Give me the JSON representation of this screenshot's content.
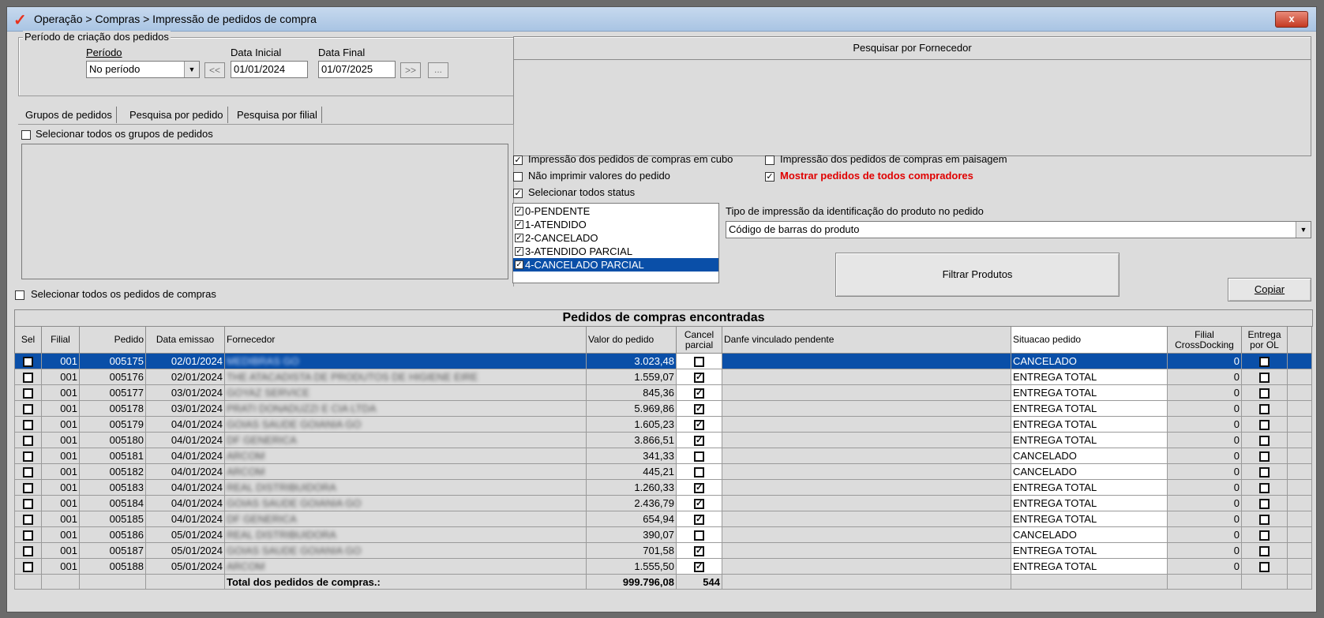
{
  "window": {
    "title": "Operação > Compras > Impressão de pedidos de compra",
    "close_label": "x"
  },
  "periodo": {
    "group_label": "Período de criação dos pedidos",
    "periodo_label": "Período",
    "periodo_value": "No período",
    "data_inicial_label": "Data Inicial",
    "data_inicial_value": "01/01/2024",
    "data_final_label": "Data Final",
    "data_final_value": "01/07/2025",
    "prev_label": "<<",
    "next_label": ">>",
    "more_label": "..."
  },
  "fornecedor": {
    "header": "Pesquisar por Fornecedor"
  },
  "tabs": [
    {
      "label": "Grupos de pedidos"
    },
    {
      "label": "Pesquisa por pedido"
    },
    {
      "label": "Pesquisa por filial"
    }
  ],
  "grupos": {
    "select_all_label": "Selecionar todos os grupos de pedidos"
  },
  "select_all_pedidos_label": "Selecionar todos os pedidos de compras",
  "options": {
    "cubo_label": "Impressão dos pedidos de compras em cubo",
    "cubo_checked": true,
    "nao_imprimir_label": "Não imprimir valores do pedido",
    "nao_imprimir_checked": false,
    "todos_status_label": "Selecionar todos status",
    "todos_status_checked": true,
    "paisagem_label": "Impressão dos pedidos de compras em paisagem",
    "paisagem_checked": false,
    "mostrar_label": "Mostrar pedidos de todos compradores",
    "mostrar_checked": true,
    "accent_red": "#e00000"
  },
  "status_list": [
    {
      "label": "0-PENDENTE",
      "checked": true
    },
    {
      "label": "1-ATENDIDO",
      "checked": true
    },
    {
      "label": "2-CANCELADO",
      "checked": true
    },
    {
      "label": "3-ATENDIDO PARCIAL",
      "checked": true
    },
    {
      "label": "4-CANCELADO PARCIAL",
      "checked": true
    }
  ],
  "tipo_impressao": {
    "label": "Tipo de impressão da identificação do produto no pedido",
    "value": "Código de barras do produto"
  },
  "filtrar_label": "Filtrar Produtos",
  "copiar_label": "Copiar",
  "grid": {
    "title": "Pedidos de compras encontradas",
    "columns": [
      "Sel",
      "Filial",
      "Pedido",
      "Data emissao",
      "Fornecedor",
      "Valor do pedido",
      "Cancel parcial",
      "Danfe vinculado pendente",
      "Situacao pedido",
      "Filial CrossDocking",
      "Entrega por OL"
    ],
    "rows": [
      {
        "filial": "001",
        "pedido": "005175",
        "data": "02/01/2024",
        "fornecedor": "MEDIBRAS GO",
        "valor": "3.023,48",
        "cancel": false,
        "situacao": "CANCELADO",
        "cross": "0"
      },
      {
        "filial": "001",
        "pedido": "005176",
        "data": "02/01/2024",
        "fornecedor": "THE ATACADISTA DE PRODUTOS DE HIGIENE EIRE",
        "valor": "1.559,07",
        "cancel": true,
        "situacao": "ENTREGA TOTAL",
        "cross": "0"
      },
      {
        "filial": "001",
        "pedido": "005177",
        "data": "03/01/2024",
        "fornecedor": "GOYAZ SERVICE",
        "valor": "845,36",
        "cancel": true,
        "situacao": "ENTREGA TOTAL",
        "cross": "0"
      },
      {
        "filial": "001",
        "pedido": "005178",
        "data": "03/01/2024",
        "fornecedor": "PRATI DONADUZZI E CIA LTDA",
        "valor": "5.969,86",
        "cancel": true,
        "situacao": "ENTREGA TOTAL",
        "cross": "0"
      },
      {
        "filial": "001",
        "pedido": "005179",
        "data": "04/01/2024",
        "fornecedor": "GOIAS SAUDE GOIANIA GO",
        "valor": "1.605,23",
        "cancel": true,
        "situacao": "ENTREGA TOTAL",
        "cross": "0"
      },
      {
        "filial": "001",
        "pedido": "005180",
        "data": "04/01/2024",
        "fornecedor": "DF GENERICA",
        "valor": "3.866,51",
        "cancel": true,
        "situacao": "ENTREGA TOTAL",
        "cross": "0"
      },
      {
        "filial": "001",
        "pedido": "005181",
        "data": "04/01/2024",
        "fornecedor": "ARCOM",
        "valor": "341,33",
        "cancel": false,
        "situacao": "CANCELADO",
        "cross": "0"
      },
      {
        "filial": "001",
        "pedido": "005182",
        "data": "04/01/2024",
        "fornecedor": "ARCOM",
        "valor": "445,21",
        "cancel": false,
        "situacao": "CANCELADO",
        "cross": "0"
      },
      {
        "filial": "001",
        "pedido": "005183",
        "data": "04/01/2024",
        "fornecedor": "REAL DISTRIBUIDORA",
        "valor": "1.260,33",
        "cancel": true,
        "situacao": "ENTREGA TOTAL",
        "cross": "0"
      },
      {
        "filial": "001",
        "pedido": "005184",
        "data": "04/01/2024",
        "fornecedor": "GOIAS SAUDE GOIANIA GO",
        "valor": "2.436,79",
        "cancel": true,
        "situacao": "ENTREGA TOTAL",
        "cross": "0"
      },
      {
        "filial": "001",
        "pedido": "005185",
        "data": "04/01/2024",
        "fornecedor": "DF GENERICA",
        "valor": "654,94",
        "cancel": true,
        "situacao": "ENTREGA TOTAL",
        "cross": "0"
      },
      {
        "filial": "001",
        "pedido": "005186",
        "data": "05/01/2024",
        "fornecedor": "REAL DISTRIBUIDORA",
        "valor": "390,07",
        "cancel": false,
        "situacao": "CANCELADO",
        "cross": "0"
      },
      {
        "filial": "001",
        "pedido": "005187",
        "data": "05/01/2024",
        "fornecedor": "GOIAS SAUDE GOIANIA GO",
        "valor": "701,58",
        "cancel": true,
        "situacao": "ENTREGA TOTAL",
        "cross": "0"
      },
      {
        "filial": "001",
        "pedido": "005188",
        "data": "05/01/2024",
        "fornecedor": "ARCOM",
        "valor": "1.555,50",
        "cancel": true,
        "situacao": "ENTREGA TOTAL",
        "cross": "0"
      }
    ],
    "footer": {
      "label": "Total dos pedidos de compras.:",
      "valor": "999.796,08",
      "cancel": "544"
    }
  }
}
